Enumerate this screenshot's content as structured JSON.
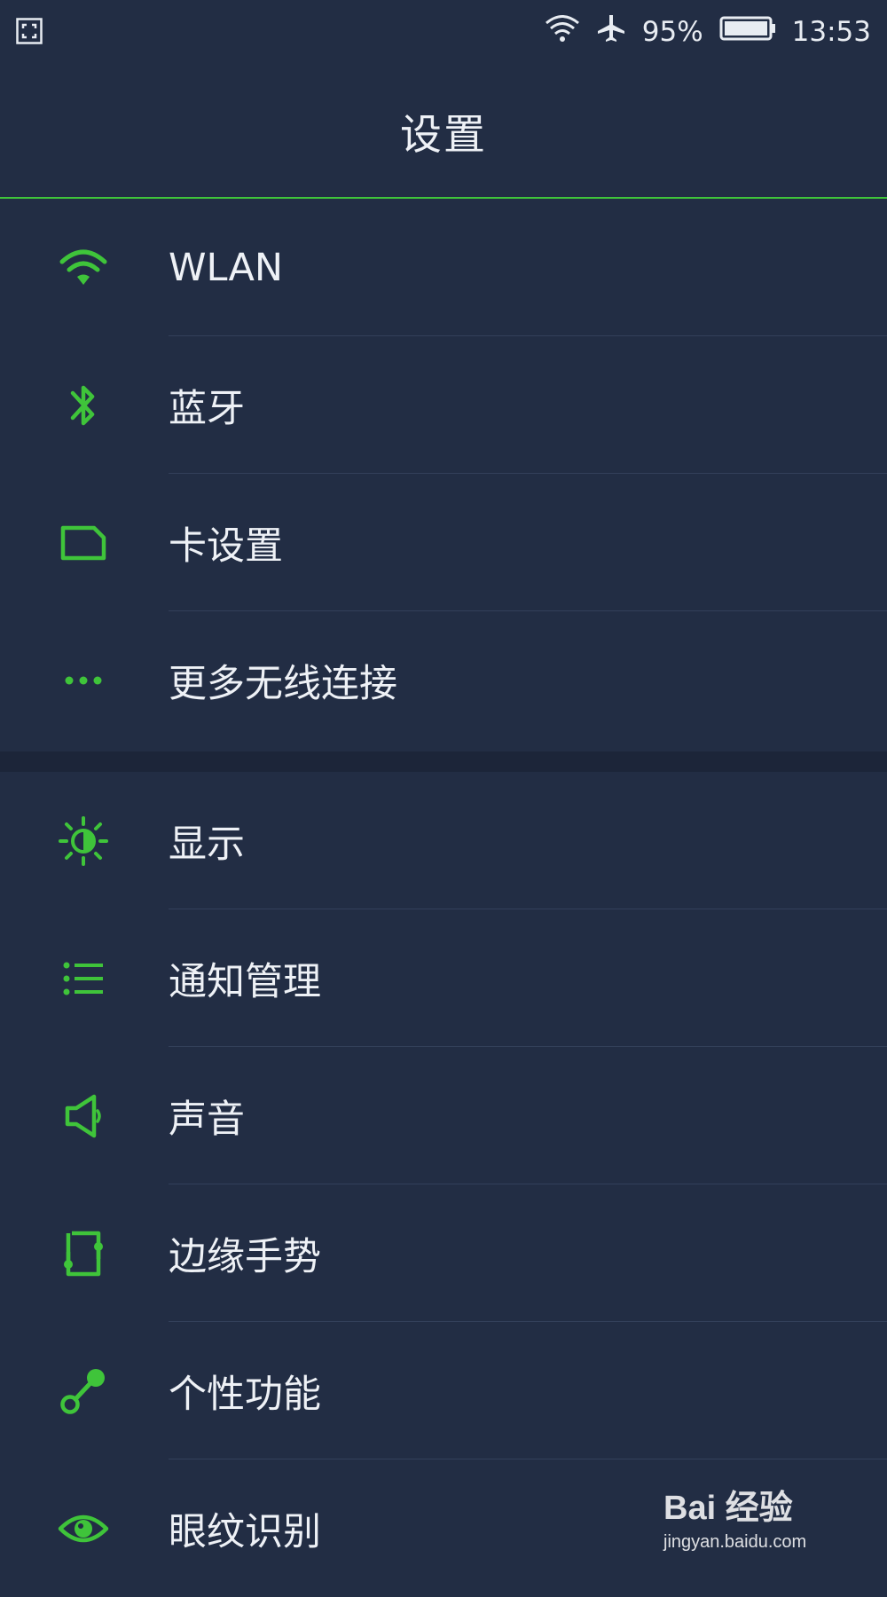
{
  "colors": {
    "accent": "#3fc43a",
    "background": "#222d44",
    "text": "#eef1f6"
  },
  "status_bar": {
    "battery": "95%",
    "time": "13:53",
    "icons": [
      "screenshot-frame-icon",
      "wifi-icon",
      "airplane-icon",
      "battery-icon"
    ]
  },
  "header": {
    "title": "设置"
  },
  "group1": [
    {
      "label": "WLAN",
      "icon": "wifi-icon"
    },
    {
      "label": "蓝牙",
      "icon": "bluetooth-icon"
    },
    {
      "label": "卡设置",
      "icon": "sim-card-icon"
    },
    {
      "label": "更多无线连接",
      "icon": "more-dots-icon"
    }
  ],
  "group2": [
    {
      "label": "显示",
      "icon": "brightness-icon"
    },
    {
      "label": "通知管理",
      "icon": "list-icon"
    },
    {
      "label": "声音",
      "icon": "speaker-icon"
    },
    {
      "label": "边缘手势",
      "icon": "edge-gesture-icon"
    },
    {
      "label": "个性功能",
      "icon": "feature-icon"
    },
    {
      "label": "眼纹识别",
      "icon": "eye-icon"
    }
  ],
  "watermark": {
    "logo": "Bai 经验",
    "url": "jingyan.baidu.com"
  }
}
